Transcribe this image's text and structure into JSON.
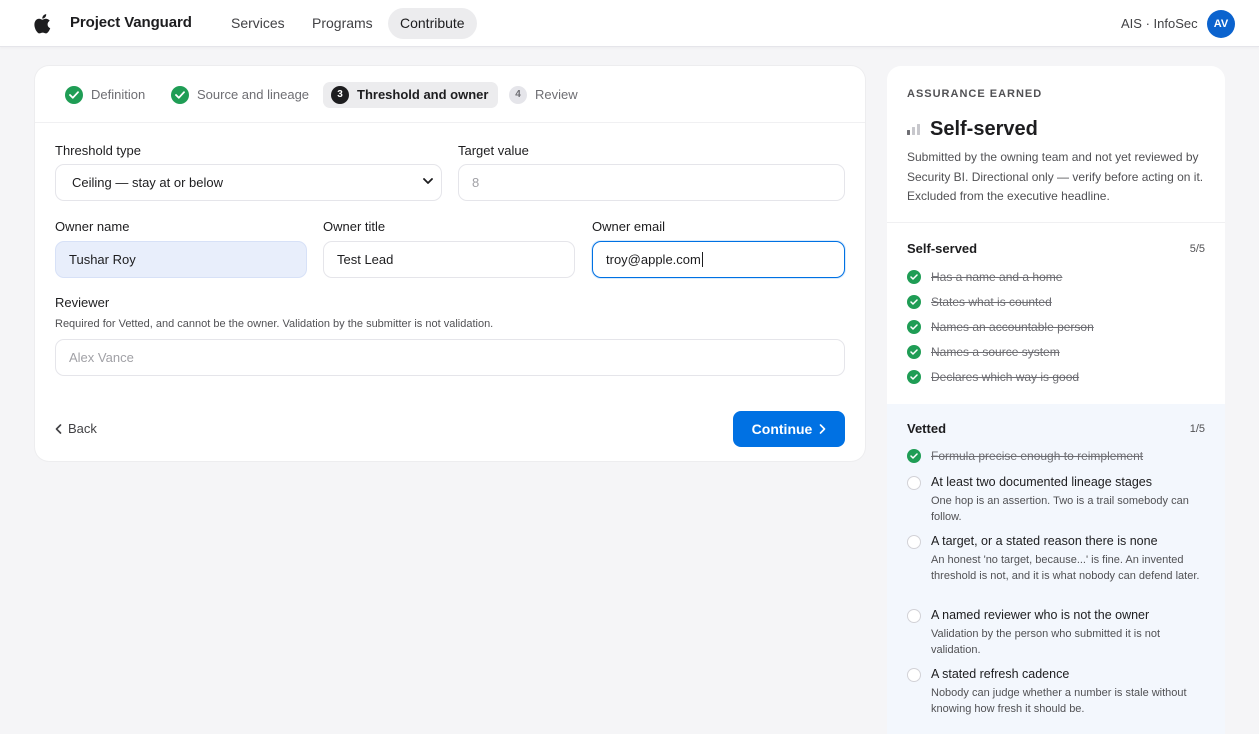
{
  "nav": {
    "brand": "Project Vanguard",
    "links": [
      "Services",
      "Programs",
      "Contribute"
    ],
    "active_link": "Contribute",
    "org": "AIS · InfoSec",
    "avatar_initials": "AV",
    "avatar_color": "#0b63ce"
  },
  "stepper": {
    "steps": [
      {
        "number": "",
        "label": "Definition",
        "state": "complete"
      },
      {
        "number": "",
        "label": "Source and lineage",
        "state": "complete"
      },
      {
        "number": "3",
        "label": "Threshold and owner",
        "state": "current"
      },
      {
        "number": "4",
        "label": "Review",
        "state": "upcoming"
      }
    ]
  },
  "form": {
    "threshold_type": {
      "label": "Threshold type",
      "value": "Ceiling — stay at or below"
    },
    "target_value": {
      "label": "Target value",
      "placeholder": "8"
    },
    "owner_name": {
      "label": "Owner name",
      "value": "Tushar Roy"
    },
    "owner_title": {
      "label": "Owner title",
      "value": "Test Lead"
    },
    "owner_email": {
      "label": "Owner email",
      "value": "troy@apple.com"
    },
    "reviewer": {
      "label": "Reviewer",
      "hint": "Required for Vetted, and cannot be the owner. Validation by the submitter is not validation.",
      "placeholder": "Alex Vance"
    }
  },
  "actions": {
    "back": "Back",
    "continue": "Continue"
  },
  "assurance": {
    "eyebrow": "ASSURANCE EARNED",
    "level": "Self-served",
    "description": "Submitted by the owning team and not yet reviewed by Security BI. Directional only — verify before acting on it. Excluded from the executive headline.",
    "self_served": {
      "title": "Self-served",
      "count": "5/5",
      "items": [
        "Has a name and a home",
        "States what is counted",
        "Names an accountable person",
        "Names a source system",
        "Declares which way is good"
      ]
    },
    "vetted": {
      "title": "Vetted",
      "count": "1/5",
      "done_items": [
        "Formula precise enough to reimplement"
      ],
      "todo_items": [
        {
          "title": "At least two documented lineage stages",
          "detail": "One hop is an assertion. Two is a trail somebody can follow."
        },
        {
          "title": "A target, or a stated reason there is none",
          "detail": "An honest 'no target, because...' is fine. An invented threshold is not, and it is what nobody can defend later."
        },
        {
          "title": "A named reviewer who is not the owner",
          "detail": "Validation by the person who submitted it is not validation."
        },
        {
          "title": "A stated refresh cadence",
          "detail": "Nobody can judge whether a number is stale without knowing how fresh it should be."
        }
      ]
    }
  },
  "colors": {
    "accent": "#0071e3",
    "success": "#1f9d55",
    "background": "#f5f5f7",
    "vetted_panel": "#f3f7fd"
  },
  "icons": [
    "apple-logo-icon",
    "check-icon",
    "chevron-down-icon",
    "chevron-left-icon",
    "chevron-right-icon",
    "signal-bars-icon"
  ]
}
